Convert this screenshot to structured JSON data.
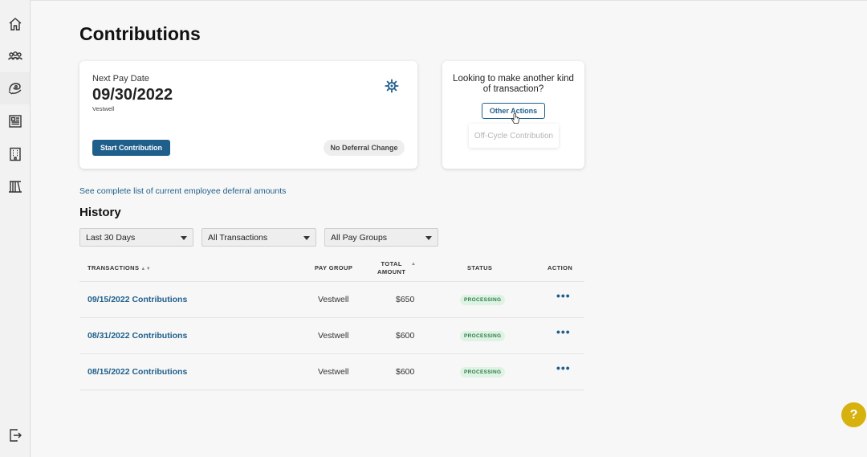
{
  "sidebar": {
    "items": [
      {
        "icon": "home-icon"
      },
      {
        "icon": "people-icon"
      },
      {
        "icon": "contributions-icon"
      },
      {
        "icon": "document-icon"
      },
      {
        "icon": "building-icon"
      },
      {
        "icon": "library-icon"
      }
    ],
    "logout_icon": "logout-icon"
  },
  "page": {
    "title": "Contributions"
  },
  "pay_card": {
    "label": "Next Pay Date",
    "date": "09/30/2022",
    "pay_group": "Vestwell",
    "start_button": "Start Contribution",
    "no_deferral_button": "No Deferral Change"
  },
  "other_card": {
    "question": "Looking to make another kind of transaction?",
    "button": "Other Actions",
    "menu_items": [
      "Off-Cycle Contribution"
    ]
  },
  "deferral_link": "See complete list of current employee deferral amounts",
  "history": {
    "title": "History",
    "filters": {
      "date_range": "Last 30 Days",
      "transaction_type": "All Transactions",
      "pay_group": "All Pay Groups"
    },
    "columns": {
      "transactions": "TRANSACTIONS",
      "pay_group": "PAY GROUP",
      "total_amount_line1": "TOTAL",
      "total_amount_line2": "AMOUNT",
      "status": "STATUS",
      "action": "ACTION"
    },
    "rows": [
      {
        "transaction": "09/15/2022 Contributions",
        "pay_group": "Vestwell",
        "amount": "$650",
        "status": "PROCESSING",
        "action": "•••"
      },
      {
        "transaction": "08/31/2022 Contributions",
        "pay_group": "Vestwell",
        "amount": "$600",
        "status": "PROCESSING",
        "action": "•••"
      },
      {
        "transaction": "08/15/2022 Contributions",
        "pay_group": "Vestwell",
        "amount": "$600",
        "status": "PROCESSING",
        "action": "•••"
      }
    ]
  },
  "help": {
    "label": "?"
  },
  "colors": {
    "primary": "#1f5f8b",
    "status_bg": "#dff3e4",
    "status_text": "#2e7d4a",
    "help": "#d7b10e"
  }
}
